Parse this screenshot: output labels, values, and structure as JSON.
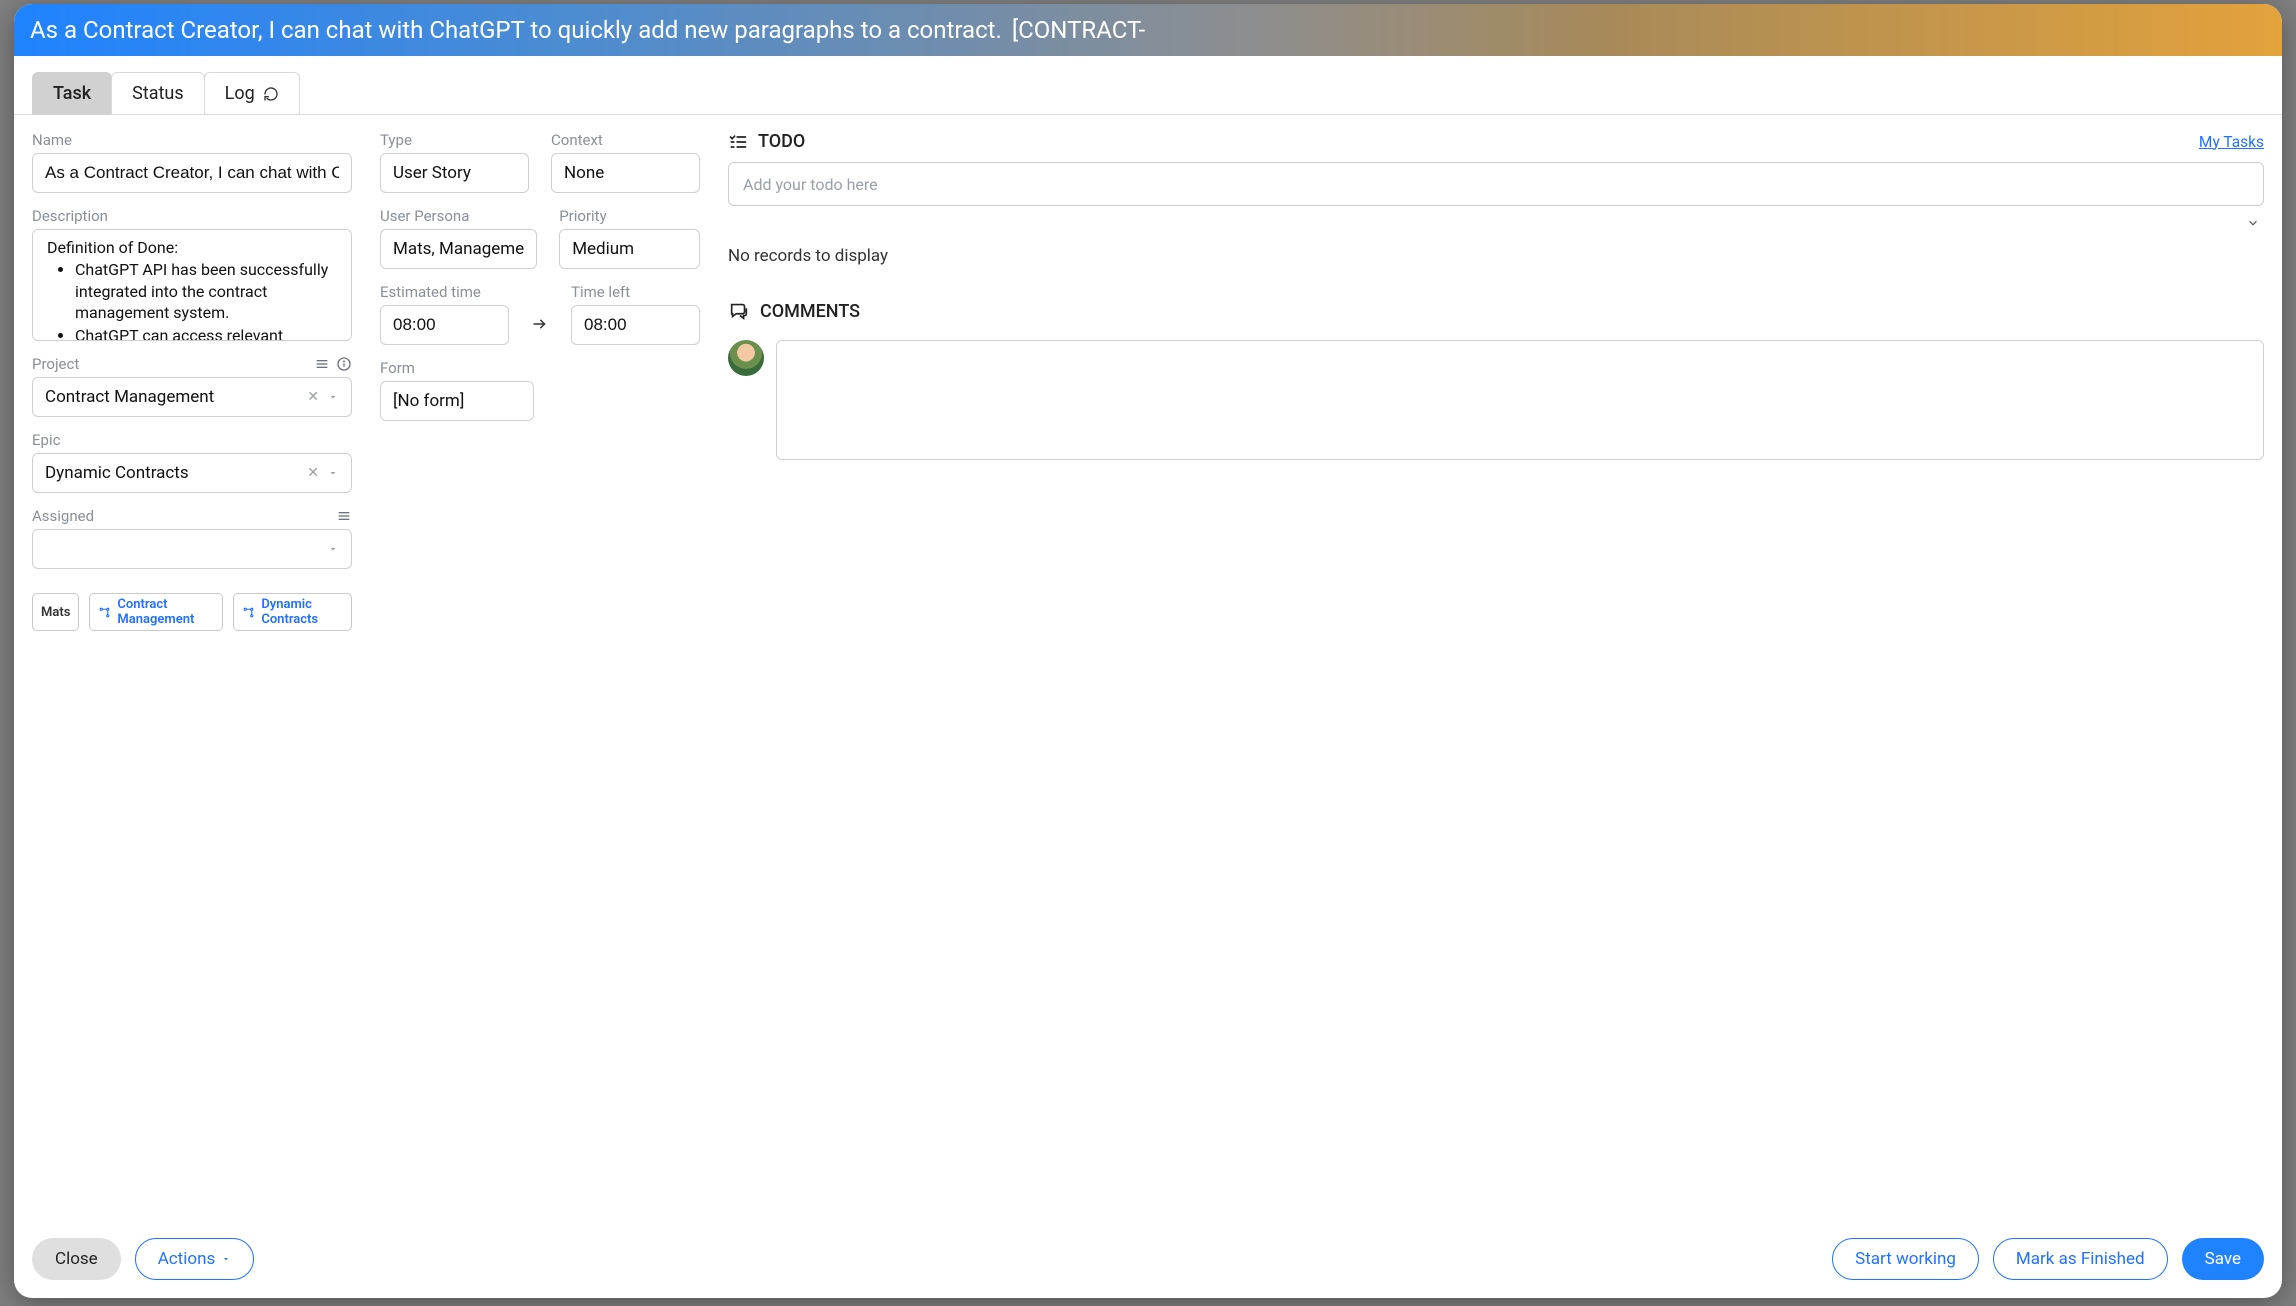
{
  "colors": {
    "accent_blue": "#1f72ff",
    "primary_blue": "#1f83ff"
  },
  "title": {
    "text": "As a Contract Creator, I can chat with ChatGPT to quickly add new paragraphs to a contract.",
    "issue_key": "[CONTRACT-"
  },
  "tabs": {
    "task": "Task",
    "status": "Status",
    "log": "Log"
  },
  "fields": {
    "name": {
      "label": "Name",
      "value": "As a Contract Creator, I can chat with ChatGPT to"
    },
    "description": {
      "label": "Description",
      "dod_title": "Definition of Done:",
      "bullets": [
        "ChatGPT API has been successfully integrated into the contract management system.",
        "ChatGPT can access relevant contract"
      ]
    },
    "project": {
      "label": "Project",
      "value": "Contract Management"
    },
    "epic": {
      "label": "Epic",
      "value": "Dynamic Contracts"
    },
    "assigned": {
      "label": "Assigned",
      "value": ""
    },
    "type": {
      "label": "Type",
      "value": "User Story"
    },
    "context": {
      "label": "Context",
      "value": "None"
    },
    "user_persona": {
      "label": "User Persona",
      "value": "Mats, Manageme"
    },
    "priority": {
      "label": "Priority",
      "value": "Medium"
    },
    "estimated_time": {
      "label": "Estimated time",
      "value": "08:00"
    },
    "time_left": {
      "label": "Time left",
      "value": "08:00"
    },
    "form": {
      "label": "Form",
      "value": "[No form]"
    }
  },
  "sidebar": {
    "todo": {
      "title": "TODO",
      "my_tasks": "My Tasks",
      "placeholder": "Add your todo here",
      "empty": "No records to display"
    },
    "comments": {
      "title": "COMMENTS"
    }
  },
  "tags": {
    "mats": "Mats",
    "project": "Contract Management",
    "epic": "Dynamic Contracts"
  },
  "footer": {
    "close": "Close",
    "actions": "Actions",
    "start": "Start working",
    "finish": "Mark as Finished",
    "save": "Save"
  }
}
